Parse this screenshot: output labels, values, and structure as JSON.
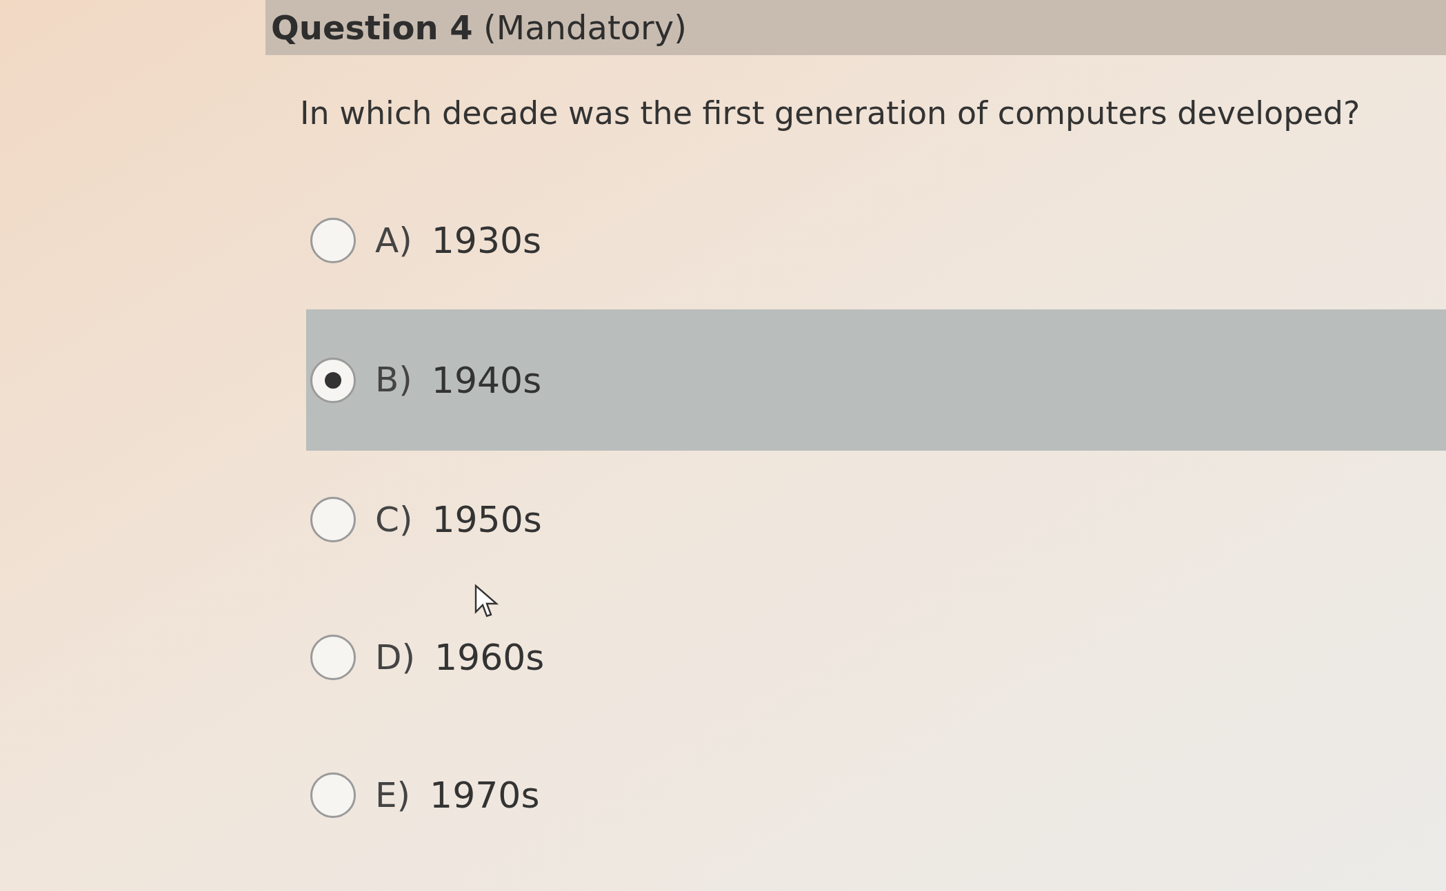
{
  "header": {
    "title": "**Question 4** (Mandatory)"
  },
  "question": "In which decade was the first generation of computers developed?",
  "options": [
    {
      "letter": "A)",
      "label": "1930s",
      "selected": false
    },
    {
      "letter": "B)",
      "label": "1940s",
      "selected": true
    },
    {
      "letter": "C)",
      "label": "1950s",
      "selected": false
    },
    {
      "letter": "D)",
      "label": "1960s",
      "selected": false
    },
    {
      "letter": "E)",
      "label": "1970s",
      "selected": false
    }
  ]
}
